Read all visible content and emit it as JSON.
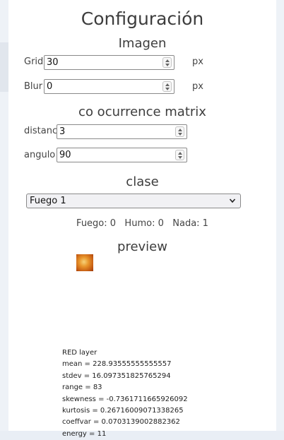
{
  "title": "Configuración",
  "imagen": {
    "heading": "Imagen",
    "grid": {
      "label": "Grid",
      "value": "30",
      "unit": "px"
    },
    "blur": {
      "label": "Blur",
      "value": "0",
      "unit": "px"
    }
  },
  "matrix": {
    "heading": "co ocurrence matrix",
    "distance": {
      "label": "distanc",
      "value": "3"
    },
    "angle": {
      "label": "angulo",
      "value": "90"
    }
  },
  "clase": {
    "heading": "clase",
    "selected": "Fuego 1",
    "counts": "Fuego: 0   Humo: 0   Nada: 1"
  },
  "preview": {
    "heading": "preview"
  },
  "stats": {
    "layer": "RED layer",
    "mean": "mean = 228.93555555555557",
    "stdev": "stdev = 16.097351825765294",
    "range": "range = 83",
    "skewness": "skewness = -0.7361711665926092",
    "kurtosis": "kurtosis = 0.26716009071338265",
    "coeffvar": "coeffvar = 0.0703139002882362",
    "energy": "energy = 11"
  }
}
